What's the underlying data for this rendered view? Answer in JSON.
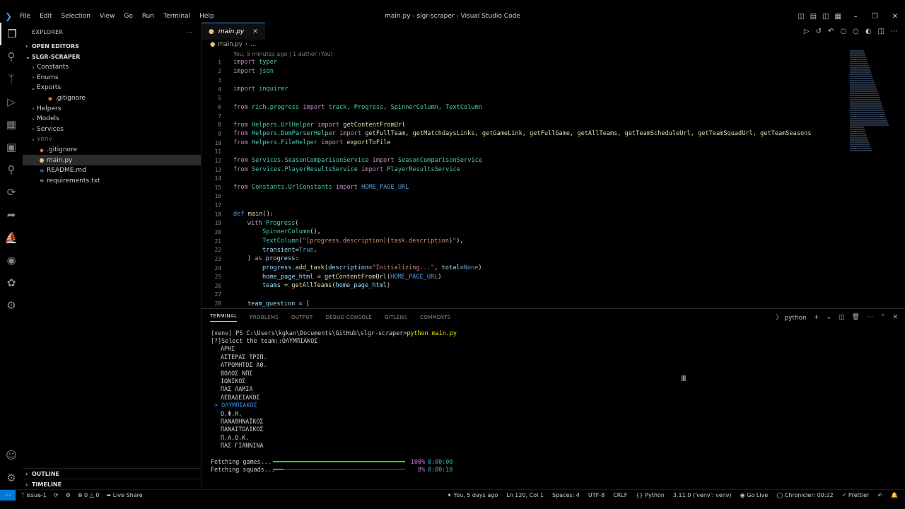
{
  "titlebar": {
    "menus": [
      "File",
      "Edit",
      "Selection",
      "View",
      "Go",
      "Run",
      "Terminal",
      "Help"
    ],
    "title": "main.py - slgr-scraper - Visual Studio Code"
  },
  "sidebar": {
    "header": "EXPLORER",
    "open_editors": "OPEN EDITORS",
    "project": "SLGR-SCRAPER",
    "tree": [
      {
        "label": "Constants",
        "type": "folder",
        "expanded": false,
        "depth": 0
      },
      {
        "label": "Enums",
        "type": "folder",
        "expanded": false,
        "depth": 0
      },
      {
        "label": "Exports",
        "type": "folder",
        "expanded": true,
        "depth": 0
      },
      {
        "label": ".gitignore",
        "type": "file",
        "depth": 1
      },
      {
        "label": "Helpers",
        "type": "folder",
        "expanded": false,
        "depth": 0
      },
      {
        "label": "Models",
        "type": "folder",
        "expanded": false,
        "depth": 0
      },
      {
        "label": "Services",
        "type": "folder",
        "expanded": false,
        "depth": 0
      },
      {
        "label": "venv",
        "type": "folder",
        "expanded": false,
        "depth": 0,
        "dim": true
      },
      {
        "label": ".gitignore",
        "type": "file",
        "depth": 0
      },
      {
        "label": "main.py",
        "type": "py",
        "depth": 0,
        "selected": true
      },
      {
        "label": "README.md",
        "type": "md",
        "depth": 0
      },
      {
        "label": "requirements.txt",
        "type": "txt",
        "depth": 0
      }
    ],
    "outline": "OUTLINE",
    "timeline": "TIMELINE"
  },
  "editor": {
    "tab": "main.py",
    "breadcrumb": [
      "main.py",
      "..."
    ],
    "codelens": "You, 5 minutes ago | 1 author (You)",
    "lines": [
      "1",
      "2",
      "3",
      "4",
      "5",
      "6",
      "7",
      "8",
      "9",
      "10",
      "11",
      "12",
      "13",
      "14",
      "15",
      "16",
      "17",
      "18",
      "19",
      "20",
      "21",
      "22",
      "23",
      "24",
      "25",
      "26",
      "27",
      "28"
    ],
    "code": {
      "l1": [
        "import",
        "typer"
      ],
      "l2": [
        "import",
        "json"
      ],
      "l4": [
        "import",
        "inquirer"
      ],
      "l6": [
        "from",
        "rich.progress",
        "import",
        "track, Progress, SpinnerColumn, TextColumn"
      ],
      "l8": [
        "from",
        "Helpers.UrlHelper",
        "import",
        "getContentFromUrl"
      ],
      "l9": [
        "from",
        "Helpers.DomParserHelper",
        "import",
        "getFullTeam, getMatchdaysLinks, getGameLink, getFullGame, getAllTeams, getTeamScheduleUrl, getTeamSquadUrl, getTeamSeasons"
      ],
      "l10": [
        "from",
        "Helpers.FileHelper",
        "import",
        "exportToFile"
      ],
      "l12": [
        "from",
        "Services.SeasonComparisonService",
        "import",
        "SeasonComparisonService"
      ],
      "l13": [
        "from",
        "Services.PlayerResultsService",
        "import",
        "PlayerResultsService"
      ],
      "l15": [
        "from",
        "Constants.UrlConstants",
        "import",
        "HOME_PAGE_URL"
      ],
      "l18": [
        "def",
        "main",
        "():"
      ],
      "l19": [
        "with",
        "Progress",
        "("
      ],
      "l20": [
        "SpinnerColumn",
        "(),"
      ],
      "l21": [
        "TextColumn",
        "(",
        "\"[progress.description]{task.description}\"",
        "),"
      ],
      "l22": [
        "transient",
        "=",
        "True",
        ","
      ],
      "l23": [
        ")",
        "as",
        "progress",
        ":"
      ],
      "l24": [
        "progress",
        ".",
        "add_task",
        "(",
        "description",
        "=",
        "\"Initializing...\"",
        ", ",
        "total",
        "=",
        "None",
        ")"
      ],
      "l25": [
        "home_page_html",
        " = ",
        "getContentFromUrl",
        "(",
        "HOME_PAGE_URL",
        ")"
      ],
      "l26": [
        "teams",
        " = ",
        "getAllTeams",
        "(",
        "home_page_html",
        ")"
      ],
      "l28": [
        "team_question",
        " = ["
      ]
    }
  },
  "panel": {
    "tabs": [
      "TERMINAL",
      "PROBLEMS",
      "OUTPUT",
      "DEBUG CONSOLE",
      "GITLENS",
      "COMMENTS"
    ],
    "shell": "python",
    "prompt": "(venv) PS C:\\Users\\kgkan\\Documents\\GitHub\\slgr-scraper>",
    "command": "python main.py",
    "question_prefix": "[?]",
    "question": "Select the team::",
    "answer": "ΟΛΥΜΠΙΑΚΟΣ",
    "options": [
      "ΑΡΗΣ",
      "ΑΣΤΕΡΑΣ ΤΡΙΠ.",
      "ΑΤΡΟΜΗΤΟΣ ΑΘ.",
      "ΒΟΛΟΣ ΝΠΣ",
      "ΙΩΝΙΚΟΣ",
      "ΠΑΣ ΛΑΜΙΑ",
      "ΛΕΒΑΔΕΙΑΚΟΣ",
      "ΟΛΥΜΠΙΑΚΟΣ",
      "Ο.Φ.Η.",
      "ΠΑΝΑΘΗΝΑΪΚΟΣ",
      "ΠΑΝΑΙΤΩΛΙΚΟΣ",
      "Π.Α.Ο.Κ.",
      "ΠΑΣ ΓΙΑΝΝΙΝΑ"
    ],
    "selected_index": 7,
    "progress": [
      {
        "label": "Fetching games...",
        "percent_text": "100%",
        "time": "0:00:00",
        "fraction": 1.0,
        "color": "#39c739"
      },
      {
        "label": "Fetching squads...",
        "percent_text": "8%",
        "time": "0:00:10",
        "fraction": 0.08,
        "color": "#e8436b"
      }
    ]
  },
  "statusbar": {
    "branch": "issue-1",
    "problems_errors": "0",
    "problems_warnings": "0",
    "live_share": "Live Share",
    "blame": "You, 5 days ago",
    "position": "Ln 120, Col 1",
    "spaces": "Spaces: 4",
    "encoding": "UTF-8",
    "eol": "CRLF",
    "language": "Python",
    "interpreter": "3.11.0 ('venv': venv)",
    "go_live": "Go Live",
    "chronicler": "Chronicler: 00:22",
    "prettier": "Prettier"
  },
  "colors": {
    "accent": "#0078d4",
    "tab_border": "#3794ff",
    "keyword": "#c586c0",
    "module": "#4ec9b0",
    "function": "#dcdcaa",
    "string": "#ce9178"
  }
}
